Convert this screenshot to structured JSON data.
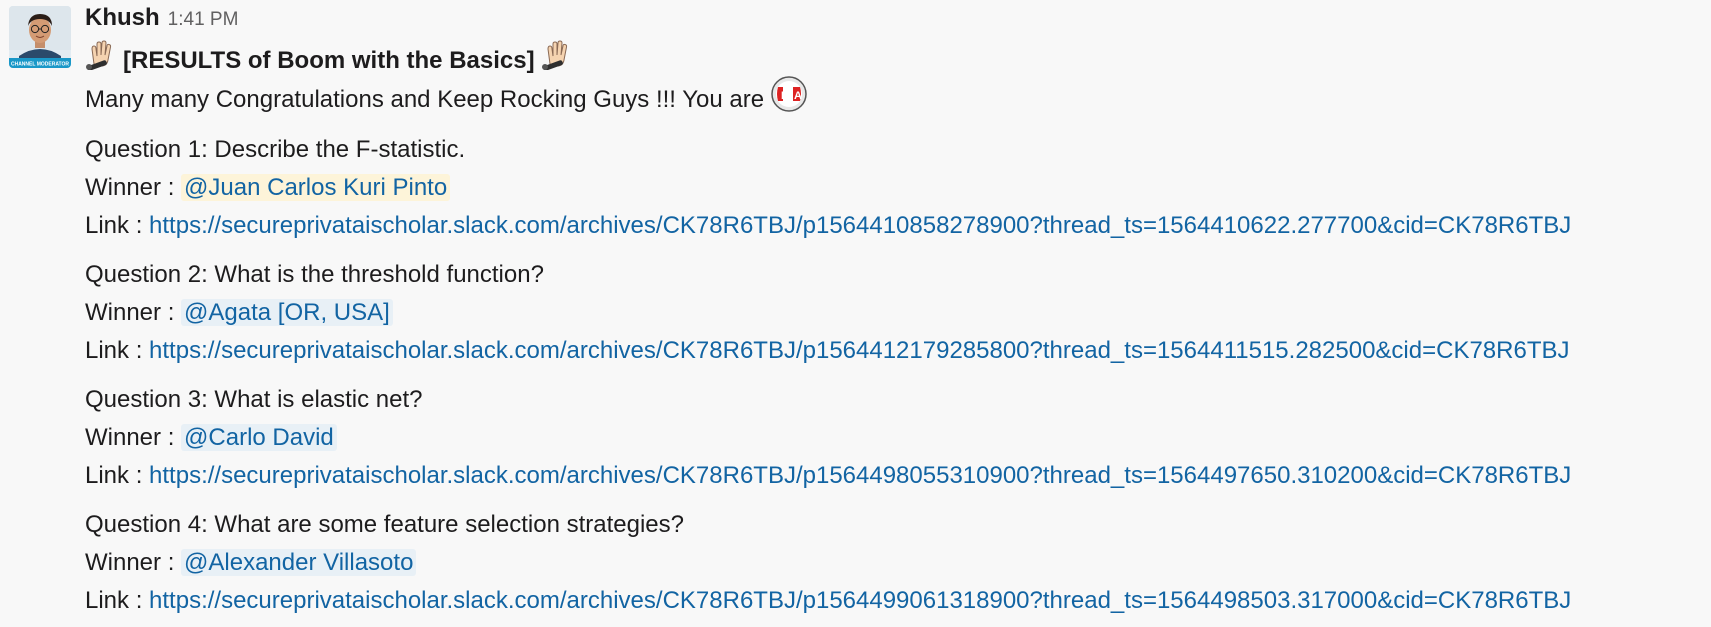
{
  "message": {
    "sender": "Khush",
    "timestamp": "1:41 PM",
    "avatar_badge": "CHANNEL MODERATOR",
    "title": "[RESULTS of Boom with the Basics]",
    "title_icon": "raised-hand-microphone",
    "intro": "Many many Congratulations and Keep Rocking Guys !!! You are",
    "intro_icon": "ea-ball-icon",
    "winner_label": "Winner : ",
    "link_label": "Link : ",
    "questions": [
      {
        "question": "Question 1: Describe the F-statistic.",
        "winner": "@Juan Carlos Kuri Pinto",
        "link": "https://secureprivataischolar.slack.com/archives/CK78R6TBJ/p1564410858278900?thread_ts=1564410622.277700&cid=CK78R6TBJ"
      },
      {
        "question": "Question 2: What is the threshold function?",
        "winner": "@Agata [OR, USA]",
        "link": "https://secureprivataischolar.slack.com/archives/CK78R6TBJ/p1564412179285800?thread_ts=1564411515.282500&cid=CK78R6TBJ"
      },
      {
        "question": "Question 3: What is elastic net?",
        "winner": "@Carlo David",
        "link": "https://secureprivataischolar.slack.com/archives/CK78R6TBJ/p1564498055310900?thread_ts=1564497650.310200&cid=CK78R6TBJ"
      },
      {
        "question": "Question 4: What are some feature selection strategies?",
        "winner": "@Alexander Villasoto",
        "link": "https://secureprivataischolar.slack.com/archives/CK78R6TBJ/p1564499061318900?thread_ts=1564498503.317000&cid=CK78R6TBJ"
      }
    ]
  },
  "colors": {
    "link": "#1264a3",
    "mention_bg": "#e8f0f6",
    "mention_highlight_bg": "#fdf4d9",
    "background": "#f8f8f8"
  }
}
